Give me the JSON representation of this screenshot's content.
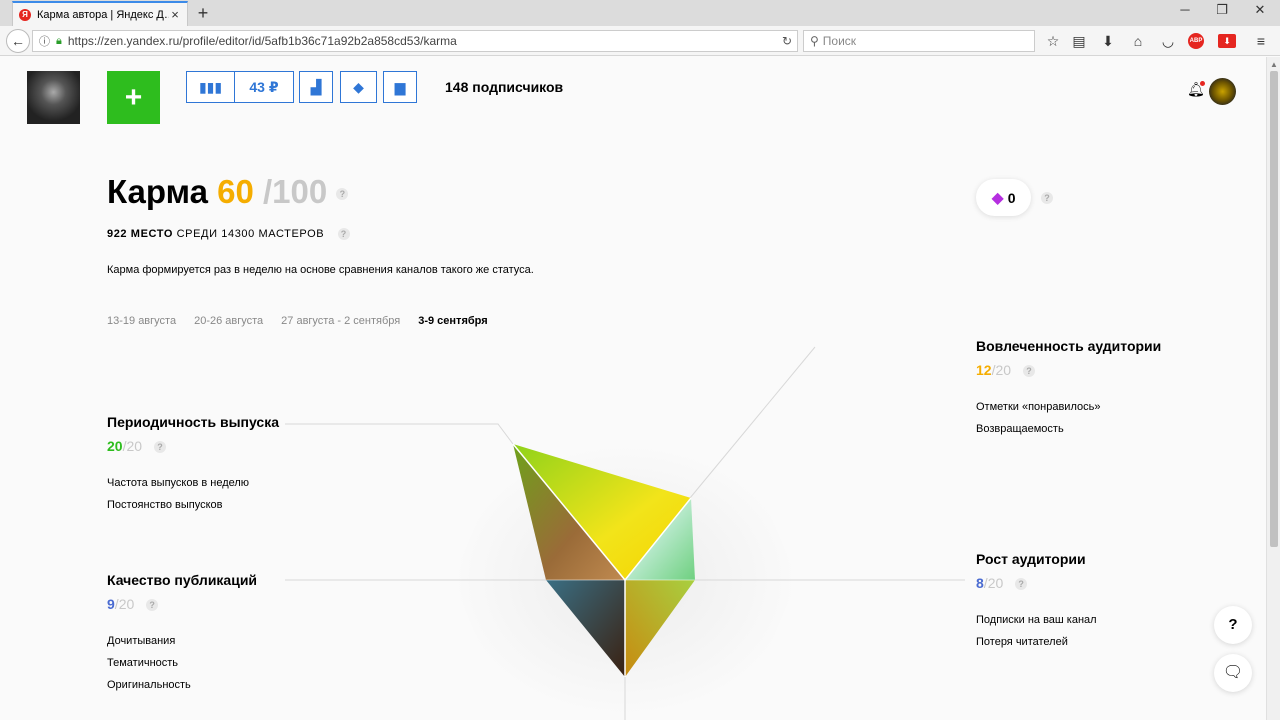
{
  "browser": {
    "tab_title": "Карма автора | Яндекс Д…",
    "url": "https://zen.yandex.ru/profile/editor/id/5afb1b36c71a92b2a858cd53/karma",
    "search_placeholder": "Поиск"
  },
  "header": {
    "money": "43 ₽",
    "subscribers": "148 подписчиков"
  },
  "karma": {
    "title": "Карма",
    "score": "60",
    "max": "/100",
    "rank_place": "922 МЕСТО",
    "rank_rest": "СРЕДИ 14300 МАСТЕРОВ",
    "description": "Карма формируется раз в неделю на основе сравнения каналов такого же статуса.",
    "weeks": [
      "13-19 августа",
      "20-26 августа",
      "27 августа - 2 сентября",
      "3-9 сентября"
    ],
    "gems": "0"
  },
  "categories": {
    "engagement": {
      "title": "Вовлеченность аудитории",
      "score": "12",
      "max": "20",
      "items": [
        "Отметки «понравилось»",
        "Возвращаемость"
      ]
    },
    "periodicity": {
      "title": "Периодичность выпуска",
      "score": "20",
      "max": "20",
      "items": [
        "Частота выпусков в неделю",
        "Постоянство выпусков"
      ]
    },
    "quality": {
      "title": "Качество публикаций",
      "score": "9",
      "max": "20",
      "items": [
        "Дочитывания",
        "Тематичность",
        "Оригинальность"
      ]
    },
    "growth": {
      "title": "Рост аудитории",
      "score": "8",
      "max": "20",
      "items": [
        "Подписки на ваш канал",
        "Потеря читателей"
      ]
    }
  },
  "misc": {
    "help": "?"
  },
  "colors": {
    "accent_green": "#2ebd1e",
    "accent_orange": "#f5ad00",
    "accent_blue": "#2f76d6"
  }
}
